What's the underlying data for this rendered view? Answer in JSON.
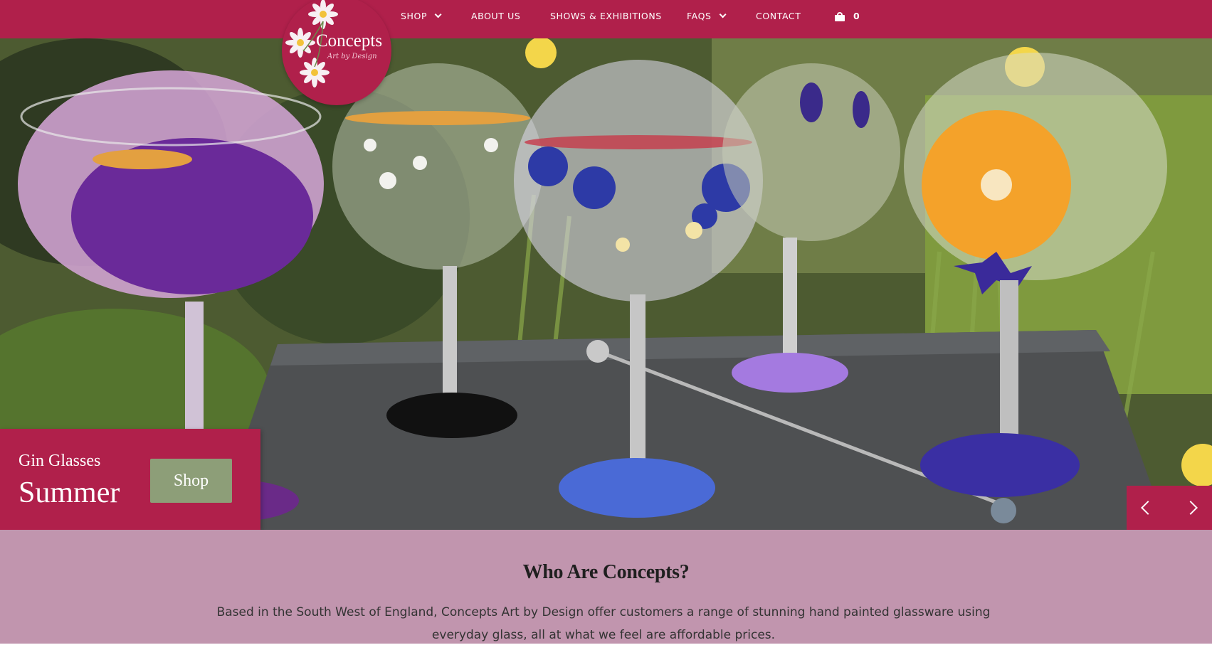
{
  "nav": {
    "items": [
      {
        "label": "SHOP",
        "dropdown": true
      },
      {
        "label": "ABOUT US",
        "dropdown": false
      },
      {
        "label": "SHOWS & EXHIBITIONS",
        "dropdown": false
      },
      {
        "label": "FAQS",
        "dropdown": true
      },
      {
        "label": "CONTACT",
        "dropdown": false
      }
    ],
    "cart_count": "0"
  },
  "logo": {
    "name": "Concepts",
    "tagline": "Art by Design"
  },
  "hero": {
    "kicker": "Gin Glasses",
    "title": "Summer",
    "button_label": "Shop"
  },
  "about": {
    "heading": "Who Are Concepts?",
    "body": "Based in the South West of England, Concepts Art by Design offer customers a range of stunning hand painted glassware using everyday glass, all at what we feel are affordable prices."
  },
  "colors": {
    "brand": "#b0204b",
    "button": "#8d9e78",
    "about_bg": "#c195ae"
  }
}
